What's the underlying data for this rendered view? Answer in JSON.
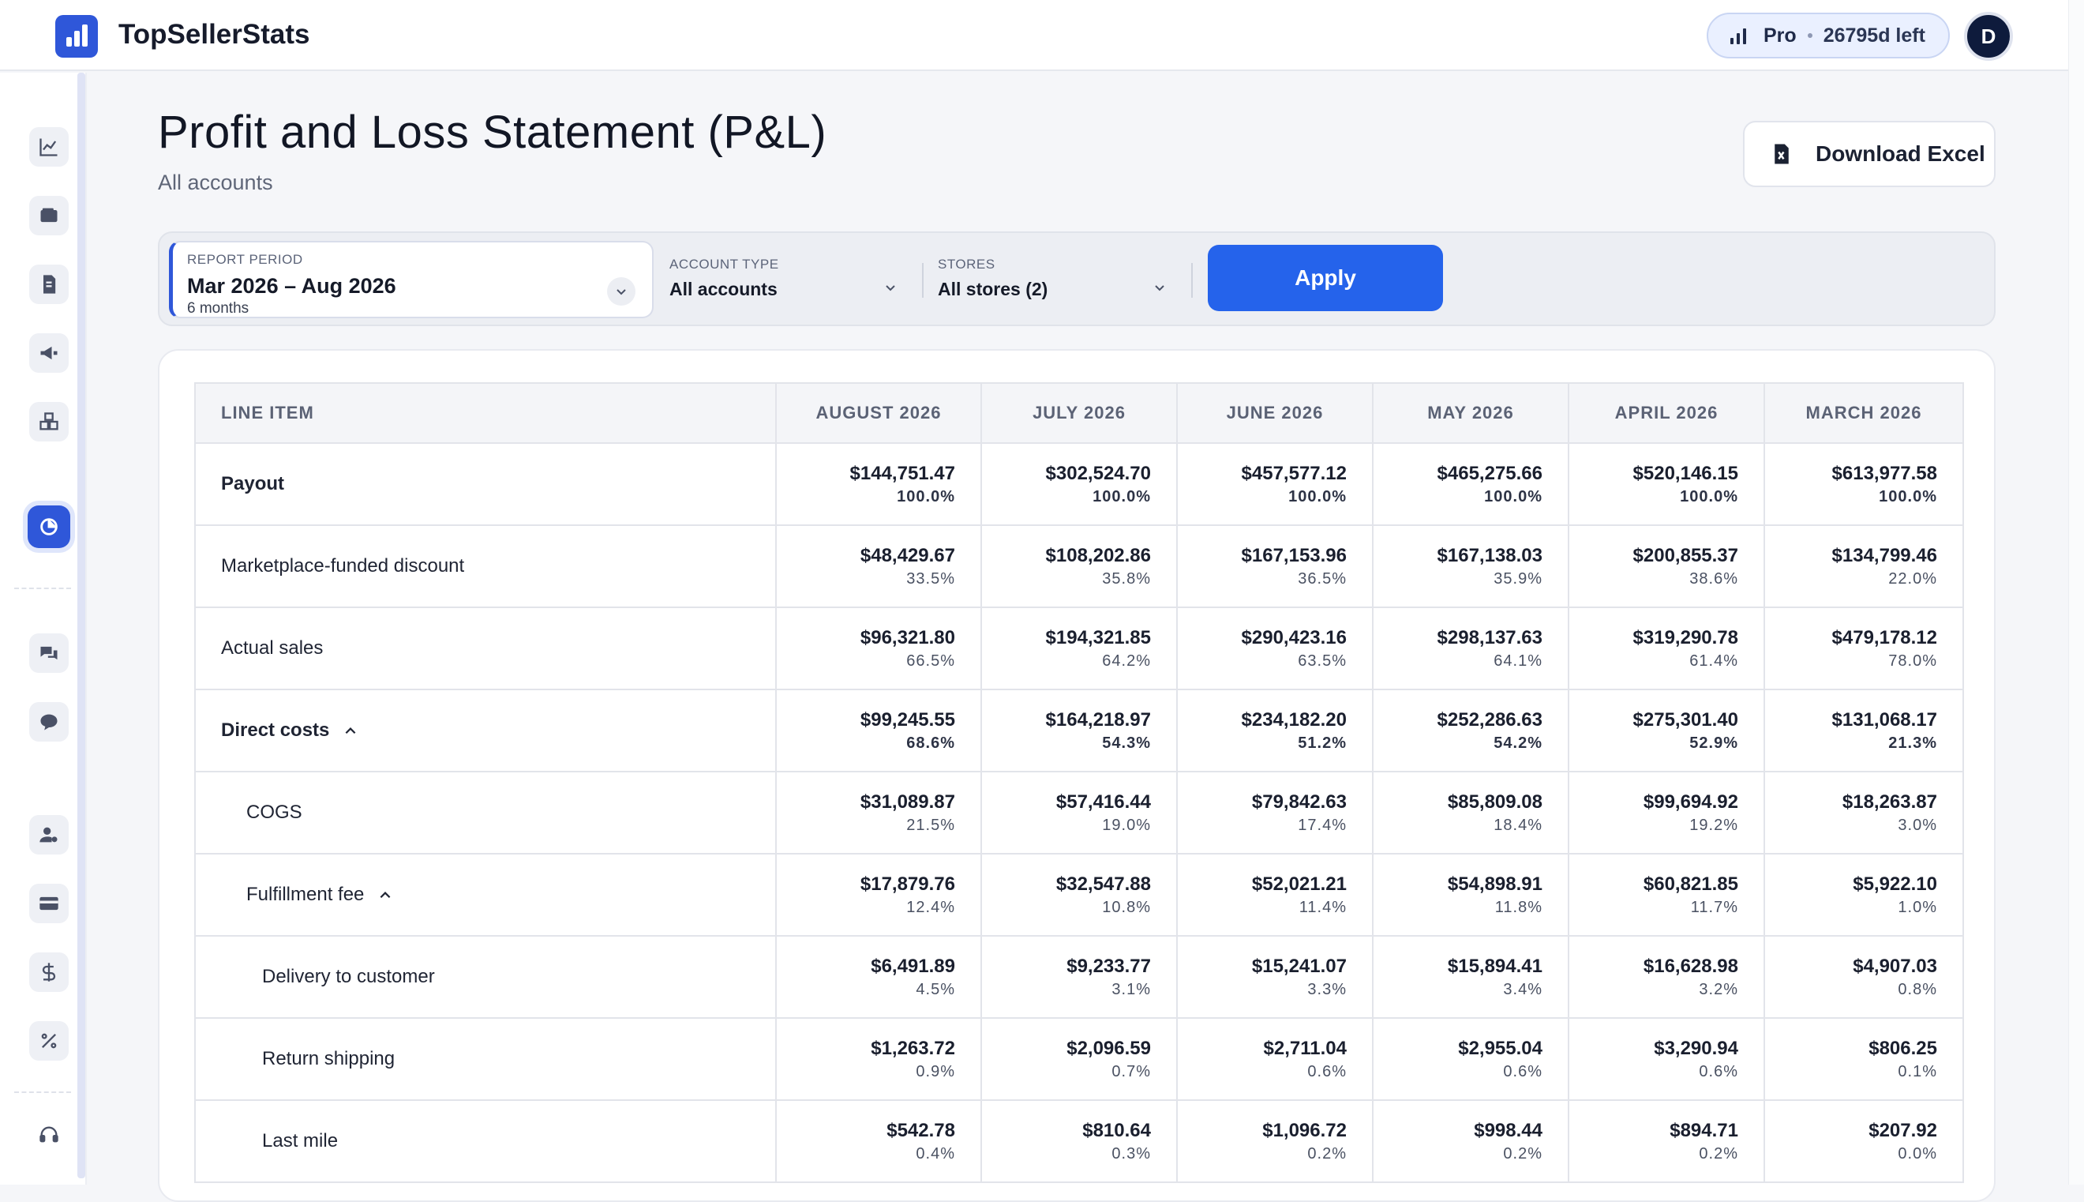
{
  "app": {
    "name": "TopSellerStats"
  },
  "plan": {
    "name": "Pro",
    "remaining": "26795d left"
  },
  "user": {
    "initial": "D"
  },
  "page": {
    "title": "Profit and Loss Statement (P&L)",
    "subtitle": "All accounts"
  },
  "actions": {
    "download_label": "Download Excel",
    "apply_label": "Apply"
  },
  "filters": {
    "period": {
      "label": "REPORT PERIOD",
      "value": "Mar 2026 – Aug 2026",
      "sub": "6 months"
    },
    "account_type": {
      "label": "ACCOUNT TYPE",
      "value": "All accounts"
    },
    "stores": {
      "label": "STORES",
      "value": "All stores (2)"
    }
  },
  "sidebar_icons": [
    "chart-line-icon",
    "wallet-icon",
    "invoice-icon",
    "megaphone-icon",
    "boxes-icon",
    "pie-chart-icon",
    "chat-icon",
    "message-icon",
    "user-settings-icon",
    "credit-card-icon",
    "dollar-icon",
    "percent-icon",
    "headset-icon"
  ],
  "table": {
    "columns": [
      "LINE ITEM",
      "AUGUST 2026",
      "JULY 2026",
      "JUNE 2026",
      "MAY 2026",
      "APRIL 2026",
      "MARCH 2026"
    ],
    "rows": [
      {
        "label": "Payout",
        "level": 0,
        "bold": true,
        "expander": false,
        "cells": [
          [
            "$144,751.47",
            "100.0%"
          ],
          [
            "$302,524.70",
            "100.0%"
          ],
          [
            "$457,577.12",
            "100.0%"
          ],
          [
            "$465,275.66",
            "100.0%"
          ],
          [
            "$520,146.15",
            "100.0%"
          ],
          [
            "$613,977.58",
            "100.0%"
          ]
        ]
      },
      {
        "label": "Marketplace-funded discount",
        "level": 0,
        "bold": false,
        "expander": false,
        "cells": [
          [
            "$48,429.67",
            "33.5%"
          ],
          [
            "$108,202.86",
            "35.8%"
          ],
          [
            "$167,153.96",
            "36.5%"
          ],
          [
            "$167,138.03",
            "35.9%"
          ],
          [
            "$200,855.37",
            "38.6%"
          ],
          [
            "$134,799.46",
            "22.0%"
          ]
        ]
      },
      {
        "label": "Actual sales",
        "level": 0,
        "bold": false,
        "expander": false,
        "cells": [
          [
            "$96,321.80",
            "66.5%"
          ],
          [
            "$194,321.85",
            "64.2%"
          ],
          [
            "$290,423.16",
            "63.5%"
          ],
          [
            "$298,137.63",
            "64.1%"
          ],
          [
            "$319,290.78",
            "61.4%"
          ],
          [
            "$479,178.12",
            "78.0%"
          ]
        ]
      },
      {
        "label": "Direct costs",
        "level": 0,
        "bold": true,
        "expander": true,
        "cells": [
          [
            "$99,245.55",
            "68.6%"
          ],
          [
            "$164,218.97",
            "54.3%"
          ],
          [
            "$234,182.20",
            "51.2%"
          ],
          [
            "$252,286.63",
            "54.2%"
          ],
          [
            "$275,301.40",
            "52.9%"
          ],
          [
            "$131,068.17",
            "21.3%"
          ]
        ]
      },
      {
        "label": "COGS",
        "level": 1,
        "bold": false,
        "expander": false,
        "cells": [
          [
            "$31,089.87",
            "21.5%"
          ],
          [
            "$57,416.44",
            "19.0%"
          ],
          [
            "$79,842.63",
            "17.4%"
          ],
          [
            "$85,809.08",
            "18.4%"
          ],
          [
            "$99,694.92",
            "19.2%"
          ],
          [
            "$18,263.87",
            "3.0%"
          ]
        ]
      },
      {
        "label": "Fulfillment fee",
        "level": 1,
        "bold": false,
        "expander": true,
        "cells": [
          [
            "$17,879.76",
            "12.4%"
          ],
          [
            "$32,547.88",
            "10.8%"
          ],
          [
            "$52,021.21",
            "11.4%"
          ],
          [
            "$54,898.91",
            "11.8%"
          ],
          [
            "$60,821.85",
            "11.7%"
          ],
          [
            "$5,922.10",
            "1.0%"
          ]
        ]
      },
      {
        "label": "Delivery to customer",
        "level": 2,
        "bold": false,
        "expander": false,
        "cells": [
          [
            "$6,491.89",
            "4.5%"
          ],
          [
            "$9,233.77",
            "3.1%"
          ],
          [
            "$15,241.07",
            "3.3%"
          ],
          [
            "$15,894.41",
            "3.4%"
          ],
          [
            "$16,628.98",
            "3.2%"
          ],
          [
            "$4,907.03",
            "0.8%"
          ]
        ]
      },
      {
        "label": "Return shipping",
        "level": 2,
        "bold": false,
        "expander": false,
        "cells": [
          [
            "$1,263.72",
            "0.9%"
          ],
          [
            "$2,096.59",
            "0.7%"
          ],
          [
            "$2,711.04",
            "0.6%"
          ],
          [
            "$2,955.04",
            "0.6%"
          ],
          [
            "$3,290.94",
            "0.6%"
          ],
          [
            "$806.25",
            "0.1%"
          ]
        ]
      },
      {
        "label": "Last mile",
        "level": 2,
        "bold": false,
        "expander": false,
        "cells": [
          [
            "$542.78",
            "0.4%"
          ],
          [
            "$810.64",
            "0.3%"
          ],
          [
            "$1,096.72",
            "0.2%"
          ],
          [
            "$998.44",
            "0.2%"
          ],
          [
            "$894.71",
            "0.2%"
          ],
          [
            "$207.92",
            "0.0%"
          ]
        ]
      }
    ]
  }
}
